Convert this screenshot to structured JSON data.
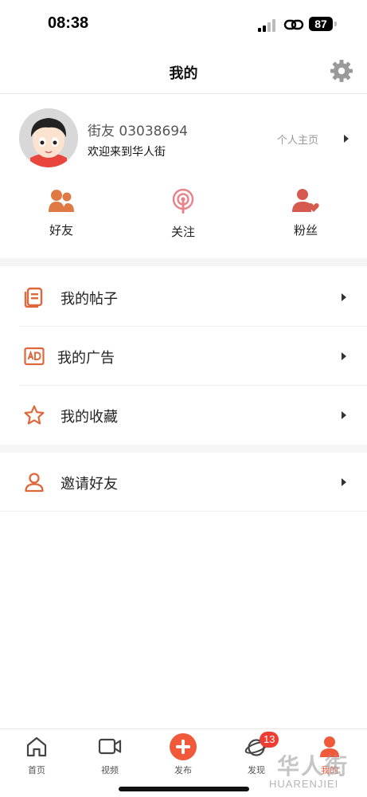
{
  "status_bar": {
    "time": "08:38",
    "battery": "87"
  },
  "header": {
    "title": "我的",
    "settings_icon": "gear-icon"
  },
  "profile": {
    "username": "街友 03038694",
    "welcome": "欢迎来到华人街",
    "homepage_label": "个人主页"
  },
  "stats": [
    {
      "label": "好友",
      "icon": "friends-icon"
    },
    {
      "label": "关注",
      "icon": "podcast-follow-icon"
    },
    {
      "label": "粉丝",
      "icon": "user-heart-icon"
    }
  ],
  "menu": [
    {
      "label": "我的帖子",
      "icon": "posts-icon"
    },
    {
      "label": "我的广告",
      "icon": "ad-icon"
    },
    {
      "label": "我的收藏",
      "icon": "star-icon"
    },
    {
      "label": "邀请好友",
      "icon": "person-icon"
    }
  ],
  "tabbar": {
    "items": [
      {
        "label": "首页",
        "icon": "home-icon"
      },
      {
        "label": "视频",
        "icon": "video-icon"
      },
      {
        "label": "发布",
        "icon": "plus-icon"
      },
      {
        "label": "发现",
        "icon": "planet-icon",
        "badge": "13"
      },
      {
        "label": "我的",
        "icon": "person-icon",
        "active": true
      }
    ]
  },
  "watermark": {
    "top": "华人街",
    "bottom": "HUARENJIEI"
  },
  "colors": {
    "accent": "#f05a3a",
    "icon_orange": "#e06a38",
    "follow_pink": "#e8838c",
    "fans_red": "#d9534f"
  }
}
